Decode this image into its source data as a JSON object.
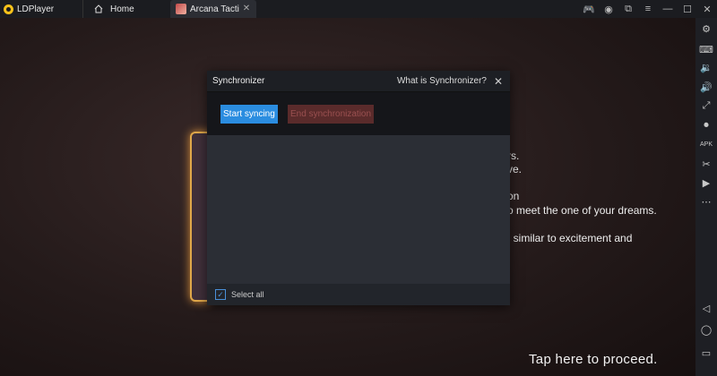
{
  "titlebar": {
    "app_name": "LDPlayer",
    "tabs": [
      {
        "label": "Home"
      },
      {
        "label": "Arcana Tacti…",
        "close": "✕"
      }
    ]
  },
  "window_controls": {
    "gamepad": "🎮",
    "user": "◉",
    "restore_box": "⧉",
    "menu": "≡",
    "minimize": "—",
    "maximize": "☐",
    "close": "✕"
  },
  "game": {
    "bg_lines": [
      "rs.",
      "ve.",
      "on",
      "o meet the one of your dreams.",
      ", similar to excitement and"
    ],
    "proceed": "Tap here to proceed."
  },
  "dialog": {
    "title": "Synchronizer",
    "help_link": "What is Synchronizer?",
    "close": "✕",
    "start_button": "Start syncing",
    "end_button": "End synchronization",
    "select_all_label": "Select all",
    "select_all_checked": true,
    "check_mark": "✓"
  },
  "toolbar_icons": [
    "settings-icon",
    "keyboard-icon",
    "volume-down-icon",
    "volume-up-icon",
    "resize-icon",
    "screen-record-icon",
    "apk-icon",
    "scissors-icon",
    "media-play-icon",
    "more-icon",
    "back-icon",
    "home-icon",
    "recent-apps-icon"
  ],
  "toolbar_glyphs": [
    "⚙",
    "⌨",
    "🔉",
    "🔊",
    "⤢",
    "⏺",
    "APK",
    "✂",
    "▶",
    "⋯",
    "◁",
    "◯",
    "▭"
  ],
  "colors": {
    "accent": "#2b8de0",
    "end_button_bg": "#5a2b2b",
    "app_logo": "#f6c21a"
  }
}
